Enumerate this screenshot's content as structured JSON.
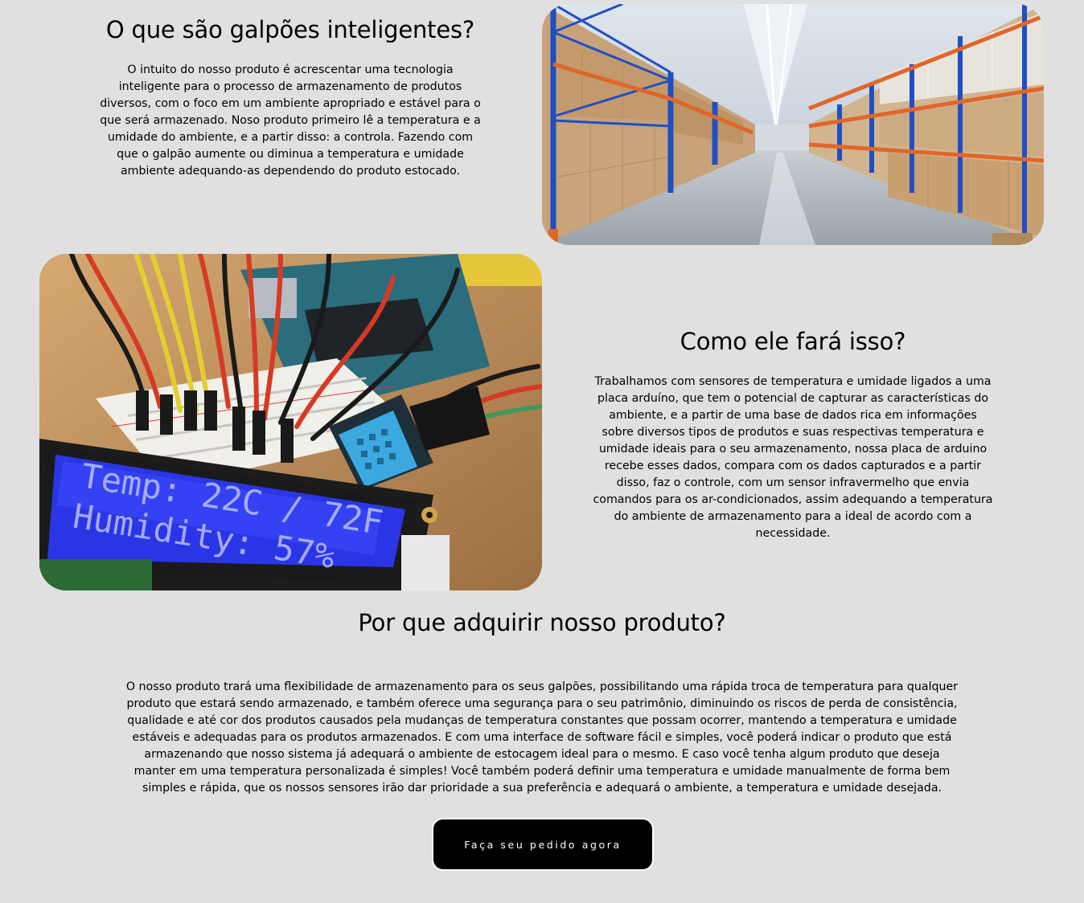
{
  "section_intro": {
    "title": "O que são galpões inteligentes?",
    "body": "O intuito do nosso produto é acrescentar uma tecnologia inteligente para o processo de armazenamento de produtos diversos, com o foco em um ambiente apropriado e estável para o que será armazenado. Noso produto primeiro lê a temperatura e a umidade do ambiente, e a partir disso: a controla. Fazendo com que o galpão aumente ou diminua a temperatura e umidade ambiente adequando-as dependendo do produto estocado."
  },
  "section_how": {
    "title": "Como ele fará isso?",
    "body": "Trabalhamos com sensores de temperatura e umidade ligados a uma placa arduíno, que tem o potencial de capturar as características do ambiente, e a partir de uma base de dados rica em informações sobre diversos tipos de produtos e suas respectivas temperatura e umidade ideais para o seu armazenamento, nossa placa de arduino recebe esses dados, compara com os dados capturados e a partir disso, faz o controle, com um sensor infravermelho que envia comandos para os ar-condicionados, assim adequando a temperatura do ambiente de armazenamento para a ideal de acordo com a necessidade."
  },
  "section_why": {
    "title": "Por que adquirir nosso produto?",
    "body": "O nosso produto trará uma flexibilidade de armazenamento para os seus galpões, possibilitando uma rápida troca de temperatura para qualquer produto que estará sendo armazenado, e também oferece uma segurança para o seu patrimônio, diminuindo os riscos de perda de consistência, qualidade e até cor dos produtos causados pela mudanças de temperatura constantes que possam ocorrer, mantendo a temperatura e umidade estáveis e adequadas para os produtos armazenados. E com uma interface de software fácil e simples, você poderá indicar o produto que está armazenando que nosso sistema já adequará o ambiente de estocagem ideal para o mesmo. E caso você tenha algum produto que deseja manter em uma temperatura personalizada é simples! Você também poderá definir uma temperatura e umidade manualmente de forma bem simples e rápida, que os nossos sensores irão dar prioridade a sua preferência e adequará o ambiente, a temperatura e umidade desejada."
  },
  "cta": {
    "label": "Faça seu pedido agora"
  },
  "lcd_display": {
    "line1": "Temp: 22C / 72F",
    "line2": "Humidity: 57%"
  },
  "colors": {
    "background": "#e0e0e0",
    "button_bg": "#000000",
    "button_text": "#ffffff",
    "rack_blue": "#1f4fc4",
    "rack_orange": "#e0662a",
    "lcd_blue": "#2a36e6"
  }
}
